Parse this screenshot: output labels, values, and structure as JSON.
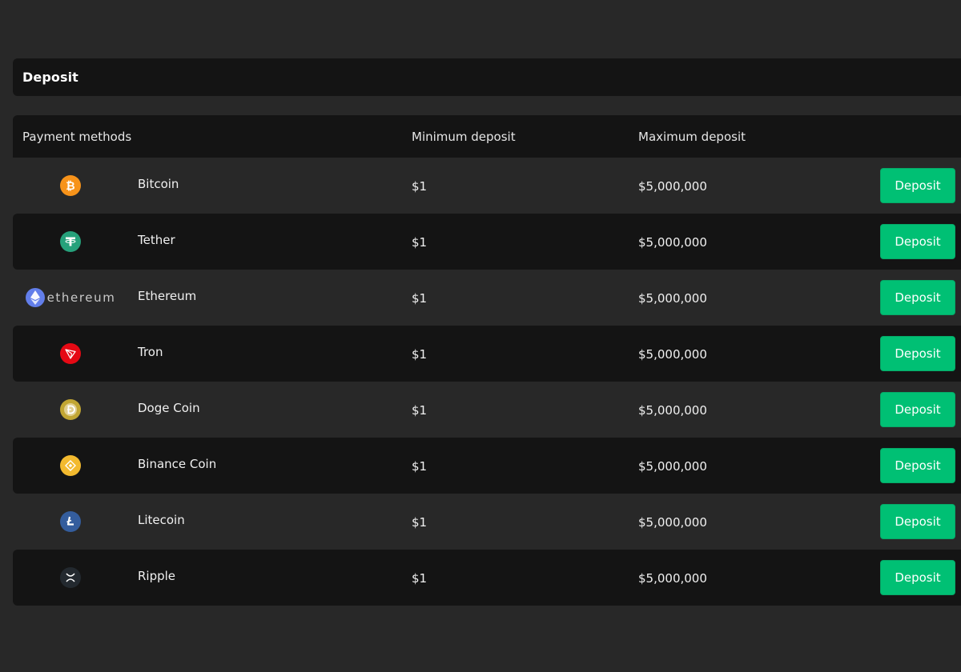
{
  "header": {
    "title": "Deposit"
  },
  "table": {
    "columns": {
      "payment": "Payment methods",
      "min": "Minimum deposit",
      "max": "Maximum deposit"
    },
    "button_label": "Deposit",
    "rows": [
      {
        "name": "Bitcoin",
        "min": "$1",
        "max": "$5,000,000",
        "icon": "bitcoin-icon",
        "color": "#f7931a"
      },
      {
        "name": "Tether",
        "min": "$1",
        "max": "$5,000,000",
        "icon": "tether-icon",
        "color": "#26a17b"
      },
      {
        "name": "Ethereum",
        "min": "$1",
        "max": "$5,000,000",
        "icon": "ethereum-icon",
        "color": "#627eea",
        "logo_text": "ethereum"
      },
      {
        "name": "Tron",
        "min": "$1",
        "max": "$5,000,000",
        "icon": "tron-icon",
        "color": "#e50914"
      },
      {
        "name": "Doge Coin",
        "min": "$1",
        "max": "$5,000,000",
        "icon": "dogecoin-icon",
        "color": "#c2a633"
      },
      {
        "name": "Binance Coin",
        "min": "$1",
        "max": "$5,000,000",
        "icon": "binance-icon",
        "color": "#f3ba2f"
      },
      {
        "name": "Litecoin",
        "min": "$1",
        "max": "$5,000,000",
        "icon": "litecoin-icon",
        "color": "#345d9d"
      },
      {
        "name": "Ripple",
        "min": "$1",
        "max": "$5,000,000",
        "icon": "ripple-icon",
        "color": "#23292f"
      }
    ]
  },
  "colors": {
    "background": "#282828",
    "panel": "#141414",
    "accent": "#00c074"
  }
}
